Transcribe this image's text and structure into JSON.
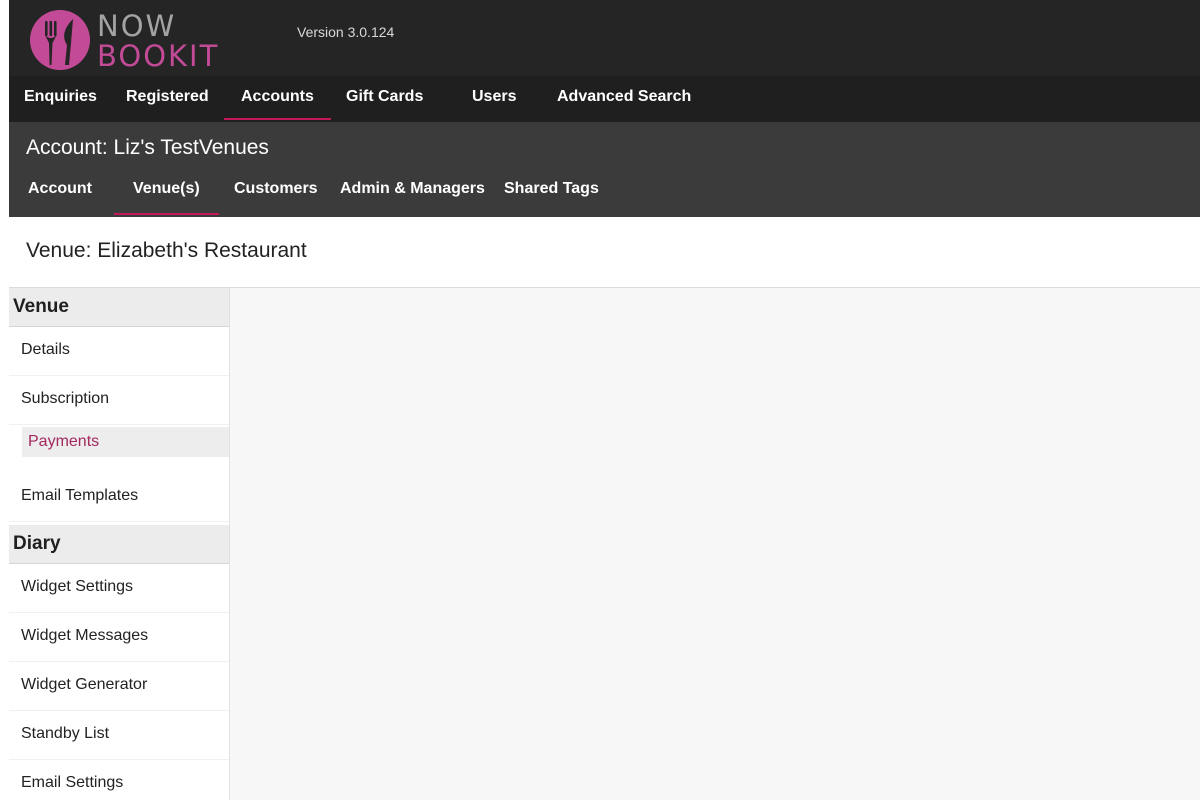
{
  "header": {
    "logo": {
      "line1": "NOW",
      "line2": "BOOKIT",
      "icon": "fork-knife-icon"
    },
    "version": "Version 3.0.124"
  },
  "main_nav": {
    "items": [
      {
        "label": "Enquiries"
      },
      {
        "label": "Registered"
      },
      {
        "label": "Accounts"
      },
      {
        "label": "Gift Cards"
      },
      {
        "label": "Users"
      },
      {
        "label": "Advanced Search"
      }
    ],
    "active": "Accounts"
  },
  "account": {
    "title": "Account: Liz's TestVenues",
    "tabs": [
      {
        "label": "Account"
      },
      {
        "label": "Venue(s)"
      },
      {
        "label": "Customers"
      },
      {
        "label": "Admin & Managers"
      },
      {
        "label": "Shared Tags"
      }
    ],
    "active": "Venue(s)"
  },
  "venue": {
    "title": "Venue: Elizabeth's Restaurant"
  },
  "sidebar": {
    "venue_section": {
      "title": "Venue",
      "items": [
        {
          "label": "Details"
        },
        {
          "label": "Subscription"
        },
        {
          "label": "Payments"
        },
        {
          "label": "Email Templates"
        }
      ],
      "active": "Payments"
    },
    "diary_section": {
      "title": "Diary",
      "items": [
        {
          "label": "Widget Settings"
        },
        {
          "label": "Widget Messages"
        },
        {
          "label": "Widget Generator"
        },
        {
          "label": "Standby List"
        },
        {
          "label": "Email Settings"
        }
      ]
    }
  },
  "colors": {
    "accent": "#c2185b",
    "logo_pink": "#c24a96",
    "active_text": "#a3295f",
    "header_bg": "#252525",
    "nav_bg": "#1f1f1f",
    "account_bg": "#3b3b3b"
  }
}
